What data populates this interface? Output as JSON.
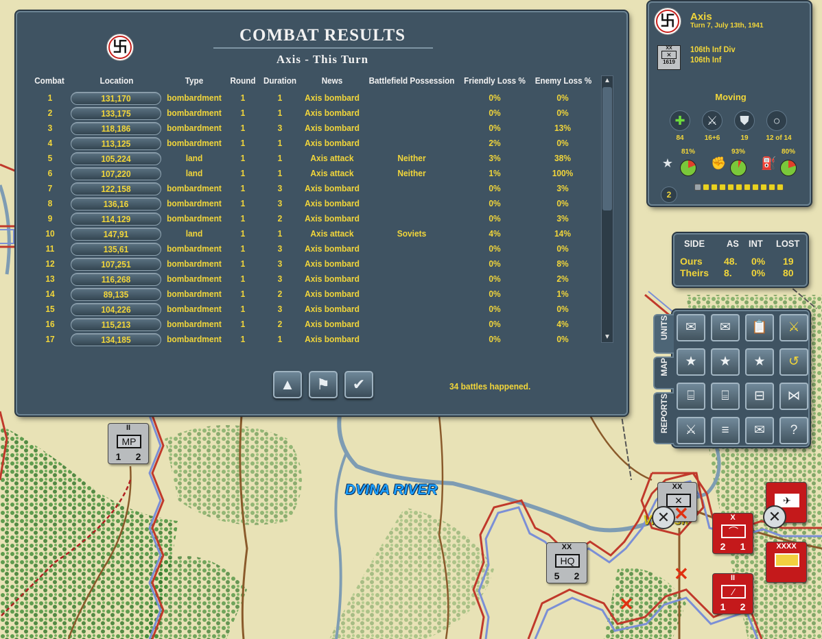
{
  "combat_results": {
    "title": "COMBAT RESULTS",
    "subtitle": "Axis - This Turn",
    "columns": [
      "Combat",
      "Location",
      "Type",
      "Round",
      "Duration",
      "News",
      "Battlefield Possession",
      "Friendly Loss %",
      "Enemy Loss %"
    ],
    "rows": [
      {
        "combat": "1",
        "location": "131,170",
        "type": "bombardment",
        "round": "1",
        "duration": "1",
        "news": "Axis bombard",
        "possession": "",
        "friendly": "0%",
        "enemy": "0%"
      },
      {
        "combat": "2",
        "location": "133,175",
        "type": "bombardment",
        "round": "1",
        "duration": "1",
        "news": "Axis bombard",
        "possession": "",
        "friendly": "0%",
        "enemy": "0%"
      },
      {
        "combat": "3",
        "location": "118,186",
        "type": "bombardment",
        "round": "1",
        "duration": "3",
        "news": "Axis bombard",
        "possession": "",
        "friendly": "0%",
        "enemy": "13%"
      },
      {
        "combat": "4",
        "location": "113,125",
        "type": "bombardment",
        "round": "1",
        "duration": "1",
        "news": "Axis bombard",
        "possession": "",
        "friendly": "2%",
        "enemy": "0%"
      },
      {
        "combat": "5",
        "location": "105,224",
        "type": "land",
        "round": "1",
        "duration": "1",
        "news": "Axis attack",
        "possession": "Neither",
        "friendly": "3%",
        "enemy": "38%"
      },
      {
        "combat": "6",
        "location": "107,220",
        "type": "land",
        "round": "1",
        "duration": "1",
        "news": "Axis attack",
        "possession": "Neither",
        "friendly": "1%",
        "enemy": "100%"
      },
      {
        "combat": "7",
        "location": "122,158",
        "type": "bombardment",
        "round": "1",
        "duration": "3",
        "news": "Axis bombard",
        "possession": "",
        "friendly": "0%",
        "enemy": "3%"
      },
      {
        "combat": "8",
        "location": "136,16",
        "type": "bombardment",
        "round": "1",
        "duration": "3",
        "news": "Axis bombard",
        "possession": "",
        "friendly": "0%",
        "enemy": "0%"
      },
      {
        "combat": "9",
        "location": "114,129",
        "type": "bombardment",
        "round": "1",
        "duration": "2",
        "news": "Axis bombard",
        "possession": "",
        "friendly": "0%",
        "enemy": "3%"
      },
      {
        "combat": "10",
        "location": "147,91",
        "type": "land",
        "round": "1",
        "duration": "1",
        "news": "Axis attack",
        "possession": "Soviets",
        "friendly": "4%",
        "enemy": "14%"
      },
      {
        "combat": "11",
        "location": "135,61",
        "type": "bombardment",
        "round": "1",
        "duration": "3",
        "news": "Axis bombard",
        "possession": "",
        "friendly": "0%",
        "enemy": "0%"
      },
      {
        "combat": "12",
        "location": "107,251",
        "type": "bombardment",
        "round": "1",
        "duration": "3",
        "news": "Axis bombard",
        "possession": "",
        "friendly": "0%",
        "enemy": "8%"
      },
      {
        "combat": "13",
        "location": "116,268",
        "type": "bombardment",
        "round": "1",
        "duration": "3",
        "news": "Axis bombard",
        "possession": "",
        "friendly": "0%",
        "enemy": "2%"
      },
      {
        "combat": "14",
        "location": "89,135",
        "type": "bombardment",
        "round": "1",
        "duration": "2",
        "news": "Axis bombard",
        "possession": "",
        "friendly": "0%",
        "enemy": "1%"
      },
      {
        "combat": "15",
        "location": "104,226",
        "type": "bombardment",
        "round": "1",
        "duration": "3",
        "news": "Axis bombard",
        "possession": "",
        "friendly": "0%",
        "enemy": "0%"
      },
      {
        "combat": "16",
        "location": "115,213",
        "type": "bombardment",
        "round": "1",
        "duration": "2",
        "news": "Axis bombard",
        "possession": "",
        "friendly": "0%",
        "enemy": "4%"
      },
      {
        "combat": "17",
        "location": "134,185",
        "type": "bombardment",
        "round": "1",
        "duration": "1",
        "news": "Axis bombard",
        "possession": "",
        "friendly": "0%",
        "enemy": "0%"
      }
    ],
    "battles_text": "34 battles happened.",
    "nav_buttons": [
      {
        "name": "scroll-up-button",
        "icon": "up-triangle-icon",
        "glyph": "▲"
      },
      {
        "name": "flag-button",
        "icon": "flag-icon",
        "glyph": "⚑"
      },
      {
        "name": "confirm-button",
        "icon": "checkmark-icon",
        "glyph": "✔"
      }
    ]
  },
  "unit_panel": {
    "side": "Axis",
    "turn": "Turn 7, July 13th, 1941",
    "unit_line1": "106th Inf Div",
    "unit_line2": "106th Inf",
    "unit_counter_top": "XX",
    "unit_counter_bottom": "1619",
    "status": "Moving",
    "stats": [
      {
        "icon": "plus-icon",
        "glyph": "✚",
        "value": "84"
      },
      {
        "icon": "crossed-swords-icon",
        "glyph": "⚔",
        "value": "16+6"
      },
      {
        "icon": "shield-icon",
        "glyph": "⛊",
        "value": "19"
      },
      {
        "icon": "circle-icon",
        "glyph": "○",
        "value": "12 of 14"
      }
    ],
    "gauges": [
      {
        "icon": "star-icon",
        "glyph": "★",
        "pct": "81%",
        "fraction": 0.81
      },
      {
        "icon": "fist-icon",
        "glyph": "✊",
        "pct": "93%",
        "fraction": 0.93
      },
      {
        "icon": "supply-icon",
        "glyph": "⛽",
        "pct": "80%",
        "fraction": 0.8
      }
    ],
    "badge": "2",
    "pips_on": 10,
    "pips_total": 11
  },
  "side_panel": {
    "headers": [
      "SIDE",
      "AS",
      "INT",
      "LOST"
    ],
    "rows": [
      {
        "side": "Ours",
        "as": "48.",
        "int": "0%",
        "lost": "19"
      },
      {
        "side": "Theirs",
        "as": "8.",
        "int": "0%",
        "lost": "80"
      }
    ]
  },
  "tool_tabs": [
    "UNITS",
    "MAP",
    "REPORTS"
  ],
  "tool_buttons": [
    {
      "name": "unit-info-button",
      "icon": "envelope-icon",
      "glyph": "✉"
    },
    {
      "name": "next-unit-button",
      "icon": "envelope-arrow-icon",
      "glyph": "✉"
    },
    {
      "name": "clipboard-button",
      "icon": "clipboard-icon",
      "glyph": "📋"
    },
    {
      "name": "attack-button",
      "icon": "crossed-swords-icon",
      "glyph": "⚔"
    },
    {
      "name": "prev-star-button",
      "icon": "star-left-icon",
      "glyph": "★"
    },
    {
      "name": "next-star-button",
      "icon": "star-right-icon",
      "glyph": "★"
    },
    {
      "name": "star-button",
      "icon": "star-icon",
      "glyph": "★"
    },
    {
      "name": "undo-button",
      "icon": "undo-icon",
      "glyph": "↺"
    },
    {
      "name": "org-chart-button",
      "icon": "org-chart-icon",
      "glyph": "⌸"
    },
    {
      "name": "org-chart-flag-button",
      "icon": "org-flag-icon",
      "glyph": "⌸"
    },
    {
      "name": "armor-button",
      "icon": "armor-icon",
      "glyph": "⊟"
    },
    {
      "name": "disband-button",
      "icon": "disband-icon",
      "glyph": "⋈"
    },
    {
      "name": "battle-report-button",
      "icon": "battle-report-icon",
      "glyph": "⚔"
    },
    {
      "name": "combat-log-button",
      "icon": "log-icon",
      "glyph": "≡"
    },
    {
      "name": "message-button",
      "icon": "message-icon",
      "glyph": "✉"
    },
    {
      "name": "help-button",
      "icon": "question-icon",
      "glyph": "?"
    }
  ],
  "map": {
    "river_label": "DVINA RIVER",
    "town_label": "Vitebsk",
    "counters": [
      {
        "name": "mp-counter",
        "style": "grey",
        "top": "II",
        "box": "MP",
        "left": "1",
        "right": "2"
      },
      {
        "name": "hq-counter",
        "style": "grey",
        "top": "XX",
        "box": "HQ",
        "left": "5",
        "right": "2"
      },
      {
        "name": "soviet-counter-a",
        "style": "red",
        "top": "X",
        "box": "",
        "left": "2",
        "right": "1"
      },
      {
        "name": "soviet-counter-b",
        "style": "red",
        "top": "II",
        "box": "",
        "left": "1",
        "right": "2"
      },
      {
        "name": "soviet-army-counter",
        "style": "red",
        "top": "XXXX",
        "box": "",
        "left": "",
        "right": ""
      }
    ],
    "colors": {
      "land": "#e8e2b6",
      "forest": "#2f7d2a",
      "river": "#7e9cb3",
      "border_red": "#c0392b",
      "border_blue": "#7b8fd6"
    }
  }
}
